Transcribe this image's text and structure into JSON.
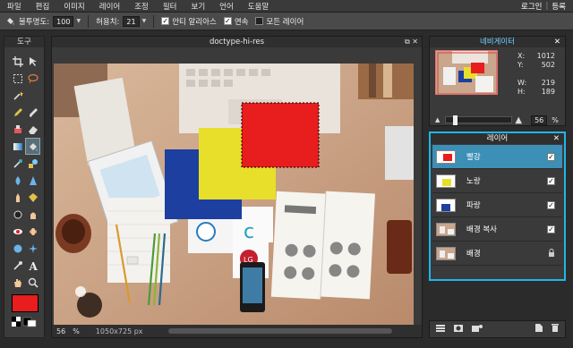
{
  "menu": {
    "items": [
      "파일",
      "편집",
      "이미지",
      "레이어",
      "조정",
      "필터",
      "보기",
      "언어",
      "도움말"
    ],
    "login": "로그인",
    "divider": "|",
    "register": "등록"
  },
  "options": {
    "opacity_label": "불투명도:",
    "opacity_value": "100",
    "tolerance_label": "허용치:",
    "tolerance_value": "21",
    "antialias_label": "안티 알리아스",
    "antialias_checked": true,
    "contiguous_label": "연속",
    "contiguous_checked": true,
    "all_layers_label": "모든 레이어",
    "all_layers_checked": false
  },
  "tools": {
    "title": "도구",
    "icons": [
      "crop-icon",
      "move-icon",
      "marquee-icon",
      "lasso-icon",
      "wand-icon",
      "blank",
      "pencil-icon",
      "brush-icon",
      "clone-icon",
      "eraser-icon",
      "gradient-icon",
      "bucket-icon",
      "replace-color-icon",
      "drawing-icon",
      "water-drop-icon",
      "sharpen-icon",
      "smudge-icon",
      "sponge-icon",
      "dodge-icon",
      "burn-icon",
      "redeye-icon",
      "spot-heal-icon",
      "bloat-icon",
      "pinch-icon",
      "picker-icon",
      "type-icon",
      "hand-icon",
      "zoom-icon"
    ],
    "foreground_color": "#e81d1d",
    "background_color": "#000000"
  },
  "document": {
    "title": "doctype-hi-res",
    "zoom": "56",
    "zoom_unit": "%",
    "dimensions": "1050x725 px"
  },
  "navigator": {
    "title": "네비게이터",
    "x_label": "X:",
    "x_value": "1012",
    "y_label": "Y:",
    "y_value": "502",
    "w_label": "W:",
    "w_value": "219",
    "h_label": "H:",
    "h_value": "189",
    "zoom_value": "56",
    "zoom_unit": "%"
  },
  "layers": {
    "title": "레이어",
    "items": [
      {
        "name": "빨강",
        "visible": true,
        "selected": true,
        "locked": false
      },
      {
        "name": "노랑",
        "visible": true,
        "selected": false,
        "locked": false
      },
      {
        "name": "파랑",
        "visible": true,
        "selected": false,
        "locked": false
      },
      {
        "name": "배경 복사",
        "visible": true,
        "selected": false,
        "locked": false
      },
      {
        "name": "배경",
        "visible": false,
        "selected": false,
        "locked": true
      }
    ]
  },
  "colors": {
    "accent": "#1fb6e8",
    "red_layer": "#e81d1d",
    "yellow_layer": "#e8df2a",
    "blue_layer": "#1c3fa0"
  }
}
